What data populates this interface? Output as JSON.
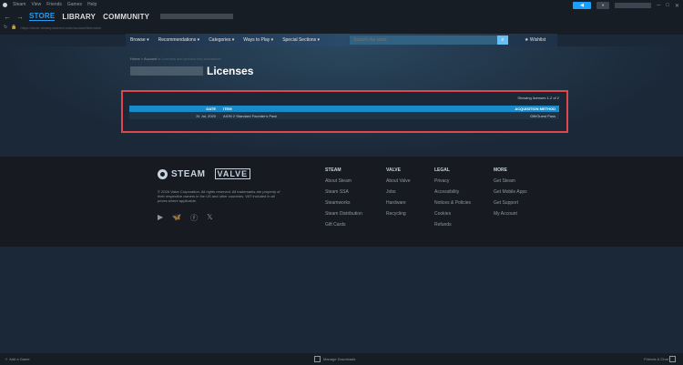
{
  "menu": [
    "Steam",
    "View",
    "Friends",
    "Games",
    "Help"
  ],
  "tabs": {
    "store": "STORE",
    "library": "LIBRARY",
    "community": "COMMUNITY"
  },
  "url": "https://store.steampowered.com/account/licenses/",
  "nav": {
    "items": [
      "Browse",
      "Recommendations",
      "Categories",
      "Ways to Play",
      "Special Sections"
    ],
    "search_placeholder": "Search the store",
    "wishlist": "Wishlist"
  },
  "breadcrumb": {
    "home": "Home",
    "sep": ">",
    "account": "Account",
    "current": "Licenses and product key activations"
  },
  "page_title": "Licenses",
  "licenses": {
    "showing": "Showing licenses 1-2 of 2",
    "headers": {
      "date": "DATE",
      "item": "ITEM",
      "method": "ACQUISITION METHOD"
    },
    "rows": [
      {
        "date": "31 Jul, 2020",
        "item": "AION 2 Standard Founder's Pack",
        "method": "Gift/Guest Pass"
      }
    ]
  },
  "footer": {
    "steam_logo": "STEAM",
    "valve_logo": "VALVE",
    "copyright": "© 2026 Valve Corporation. All rights reserved. All trademarks are property of their respective owners in the US and other countries. VAT included in all prices where applicable.",
    "columns": [
      {
        "title": "STEAM",
        "links": [
          "About Steam",
          "Steam SSA",
          "Steamworks",
          "Steam Distribution",
          "Gift Cards"
        ]
      },
      {
        "title": "VALVE",
        "links": [
          "About Valve",
          "Jobs",
          "Hardware",
          "Recycling"
        ]
      },
      {
        "title": "LEGAL",
        "links": [
          "Privacy",
          "Accessibility",
          "Notices & Policies",
          "Cookies",
          "Refunds"
        ]
      },
      {
        "title": "MORE",
        "links": [
          "Get Steam",
          "Get Mobile Apps",
          "Get Support",
          "My Account"
        ]
      }
    ]
  },
  "bottombar": {
    "add_game": "Add a Game",
    "downloads": "Manage Downloads",
    "friends": "Friends & Chat"
  }
}
